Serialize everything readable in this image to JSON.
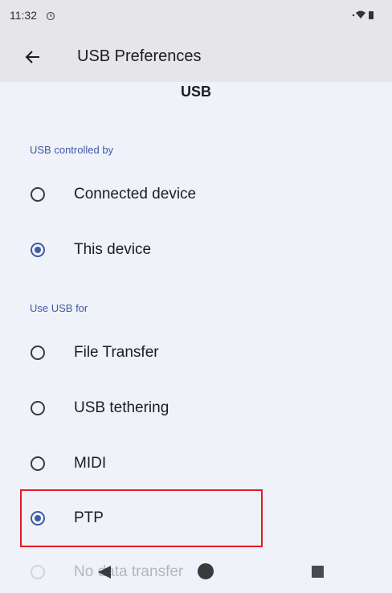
{
  "status_bar": {
    "time": "11:32",
    "icons": [
      "clock-icon",
      "wifi-icon",
      "battery-icon"
    ]
  },
  "app_bar": {
    "back_icon": "arrow-left-icon",
    "title": "USB Preferences"
  },
  "page": {
    "section_title": "USB"
  },
  "usb_controlled_by": {
    "header": "USB controlled by",
    "options": [
      {
        "label": "Connected device",
        "checked": false
      },
      {
        "label": "This device",
        "checked": true
      }
    ]
  },
  "use_usb_for": {
    "header": "Use USB for",
    "options": [
      {
        "label": "File Transfer",
        "checked": false
      },
      {
        "label": "USB tethering",
        "checked": false
      },
      {
        "label": "MIDI",
        "checked": false
      },
      {
        "label": "PTP",
        "checked": true
      },
      {
        "label": "No data transfer",
        "checked": false
      }
    ]
  },
  "colors": {
    "accent": "#3f5aa8",
    "highlight": "#e31b23",
    "bar_background": "#e6e6e9",
    "page_background": "#f0f2f9"
  }
}
